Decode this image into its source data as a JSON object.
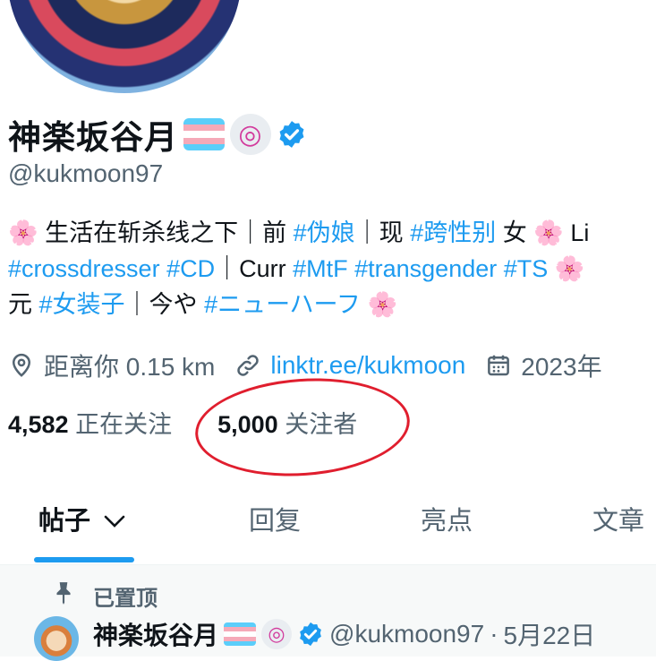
{
  "profile": {
    "display_name": "神楽坂谷月",
    "handle": "@kukmoon97",
    "spiral_glyph": "◎",
    "bio": {
      "line1": [
        {
          "t": "🌸",
          "k": "emoji"
        },
        {
          "t": " 生活在斩杀线之下｜前 ",
          "k": "text"
        },
        {
          "t": "#伪娘",
          "k": "tag"
        },
        {
          "t": "｜现 ",
          "k": "text"
        },
        {
          "t": "#跨性别",
          "k": "tag"
        },
        {
          "t": " 女 ",
          "k": "text"
        },
        {
          "t": "🌸",
          "k": "emoji"
        },
        {
          "t": " Li",
          "k": "text"
        }
      ],
      "line2": [
        {
          "t": "#crossdresser",
          "k": "tag"
        },
        {
          "t": " ",
          "k": "text"
        },
        {
          "t": "#CD",
          "k": "tag"
        },
        {
          "t": "｜Curr ",
          "k": "text"
        },
        {
          "t": "#MtF",
          "k": "tag"
        },
        {
          "t": " ",
          "k": "text"
        },
        {
          "t": "#transgender",
          "k": "tag"
        },
        {
          "t": " ",
          "k": "text"
        },
        {
          "t": "#TS",
          "k": "tag"
        },
        {
          "t": " ",
          "k": "text"
        },
        {
          "t": "🌸",
          "k": "emoji"
        }
      ],
      "line3": [
        {
          "t": "元 ",
          "k": "text"
        },
        {
          "t": "#女装子",
          "k": "tag"
        },
        {
          "t": "｜今や ",
          "k": "text"
        },
        {
          "t": "#ニューハーフ",
          "k": "tag"
        },
        {
          "t": " ",
          "k": "text"
        },
        {
          "t": "🌸",
          "k": "emoji"
        }
      ]
    },
    "location": "距离你 0.15 km",
    "link": "linktr.ee/kukmoon",
    "joined": "2023年",
    "following_count": "4,582",
    "following_label": "正在关注",
    "followers_count": "5,000",
    "followers_label": "关注者"
  },
  "tabs": [
    {
      "label": "帖子"
    },
    {
      "label": "回复"
    },
    {
      "label": "亮点"
    },
    {
      "label": "文章"
    }
  ],
  "pinned": {
    "label": "已置顶",
    "author_name": "神楽坂谷月",
    "author_handle": "@kukmoon97",
    "separator": "·",
    "date": "5月22日"
  },
  "colors": {
    "accent": "#1d9bf0",
    "muted": "#536471",
    "annotation_circle": "#e01e2e",
    "trans_blue": "#5bcefa",
    "trans_pink": "#f5a9b8"
  }
}
